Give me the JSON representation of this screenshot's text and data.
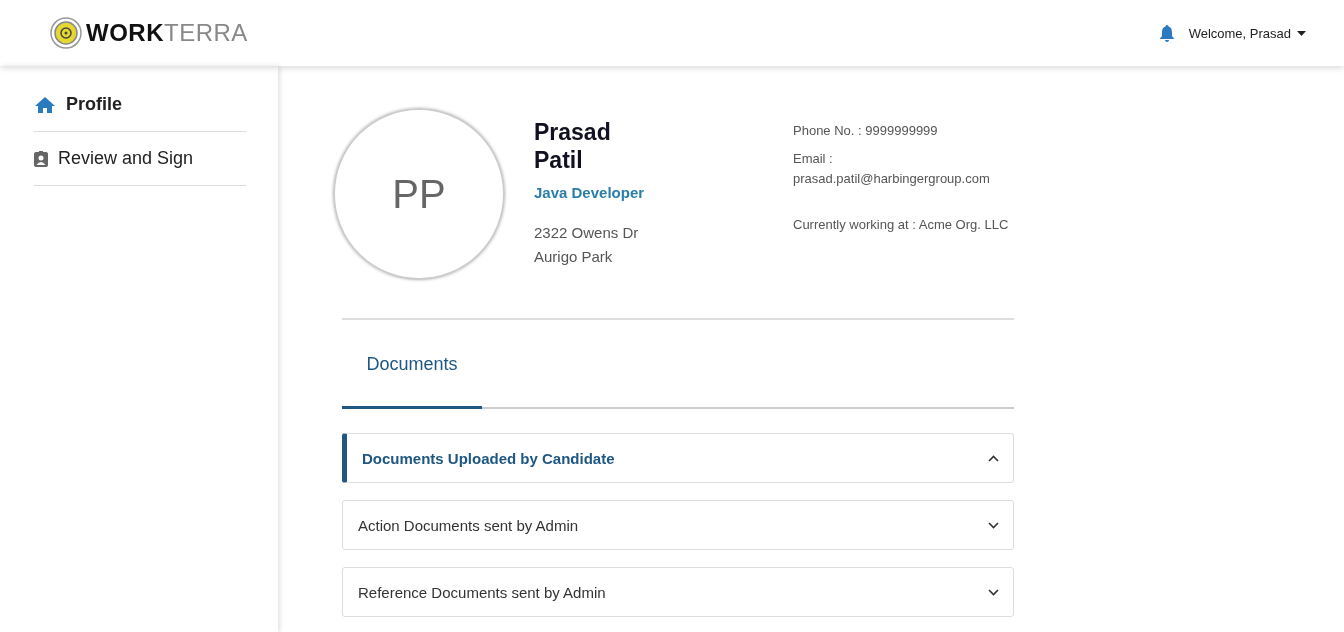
{
  "header": {
    "logo": "**WORK**TERRA",
    "user_menu": "Welcome, Prasad"
  },
  "sidebar": {
    "items": [
      {
        "label": "Profile",
        "kind": "home",
        "selected": true
      },
      {
        "label": "Review and Sign",
        "kind": "badge",
        "selected": false
      }
    ]
  },
  "profile": {
    "initials": "PP",
    "first_name": "Prasad",
    "last_name": "Patil",
    "title": "Java Developer",
    "address": [
      "2322 Owens Dr",
      "Aurigo Park"
    ],
    "phone": "Phone No. : 9999999999",
    "email_label": "Email :",
    "email": "prasad.patil@harbingergroup.com",
    "employer": "Currently working at : Acme Org. LLC"
  },
  "tabs": [
    {
      "label": "Documents",
      "selected": true
    }
  ],
  "sections": [
    {
      "title": "Documents Uploaded by Candidate",
      "expanded": true
    },
    {
      "title": "Action Documents sent by Admin",
      "expanded": false
    },
    {
      "title": "Reference Documents sent by Admin",
      "expanded": false
    }
  ]
}
